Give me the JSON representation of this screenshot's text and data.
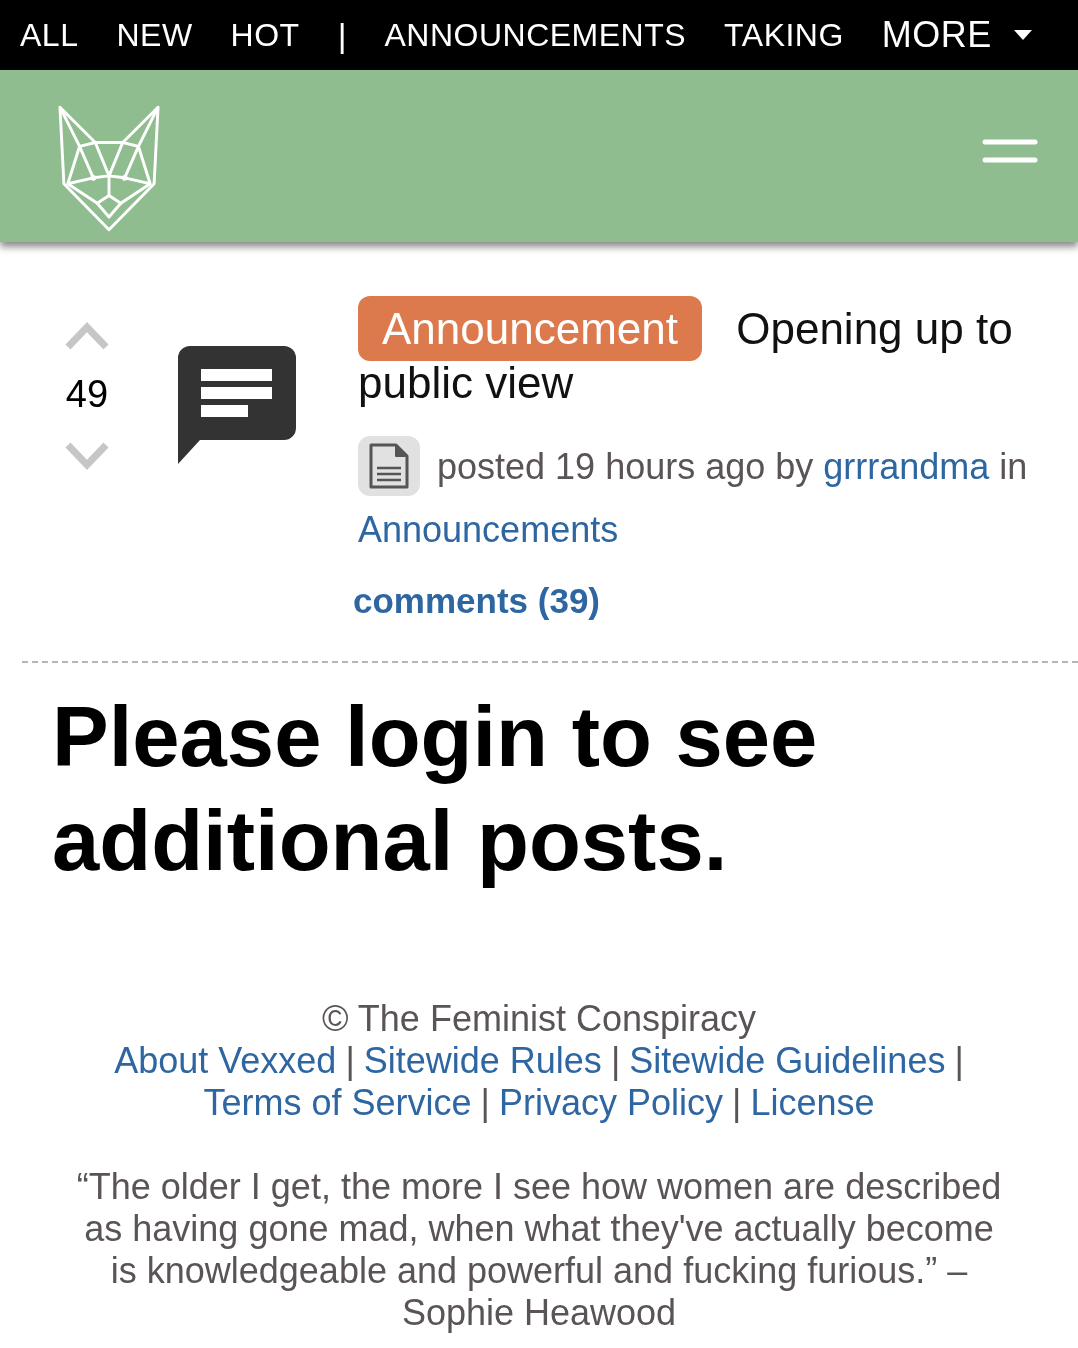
{
  "top_nav": {
    "items": [
      {
        "kind": "link",
        "label": "ALL"
      },
      {
        "kind": "link",
        "label": "NEW"
      },
      {
        "kind": "link",
        "label": "HOT"
      },
      {
        "kind": "separator",
        "label": "|"
      },
      {
        "kind": "link",
        "label": "ANNOUNCEMENTS"
      },
      {
        "kind": "link",
        "label": "TAKING"
      },
      {
        "kind": "dropdown",
        "label": "MORE"
      }
    ]
  },
  "post": {
    "score": "49",
    "flair": "Announcement",
    "title": "Opening up to public view",
    "meta": {
      "posted": "posted 19 hours ago by",
      "author": "grrrandma",
      "joiner": "in",
      "community": "Announcements"
    },
    "comments_link": "comments (39)"
  },
  "login_notice": "Please login to see additional posts.",
  "footer": {
    "copyright": "© The Feminist Conspiracy",
    "link_rows": [
      [
        {
          "kind": "link",
          "label": "About Vexxed"
        },
        {
          "kind": "separator",
          "label": "|"
        },
        {
          "kind": "link",
          "label": "Sitewide Rules"
        },
        {
          "kind": "separator",
          "label": "|"
        },
        {
          "kind": "link",
          "label": "Sitewide Guidelines"
        },
        {
          "kind": "separator",
          "label": "|"
        }
      ],
      [
        {
          "kind": "link",
          "label": "Terms of Service"
        },
        {
          "kind": "separator",
          "label": "|"
        },
        {
          "kind": "link",
          "label": "Privacy Policy"
        },
        {
          "kind": "separator",
          "label": "|"
        },
        {
          "kind": "link",
          "label": "License"
        }
      ]
    ],
    "quote": "“The older I get, the more I see how women are described as having gone mad, when what they've actually become is knowledgeable and powerful and fucking furious.” – Sophie Heawood"
  }
}
